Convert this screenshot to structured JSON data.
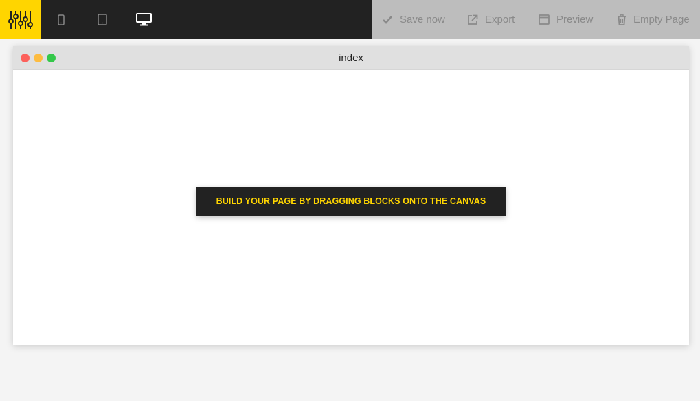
{
  "toolbar": {
    "logo_icon": "sliders-icon",
    "devices": [
      {
        "name": "mobile",
        "icon": "phone-icon",
        "active": false
      },
      {
        "name": "tablet",
        "icon": "tablet-icon",
        "active": false
      },
      {
        "name": "desktop",
        "icon": "desktop-icon",
        "active": true
      }
    ],
    "actions": {
      "save_label": "Save now",
      "export_label": "Export",
      "preview_label": "Preview",
      "empty_label": "Empty Page"
    }
  },
  "browser": {
    "title": "index",
    "hint": "BUILD YOUR PAGE BY DRAGGING BLOCKS ONTO THE CANVAS"
  },
  "colors": {
    "accent": "#ffd500",
    "toolbar_bg": "#222222",
    "actions_bg": "#bdbdbd",
    "actions_text": "#8a8a8a"
  }
}
